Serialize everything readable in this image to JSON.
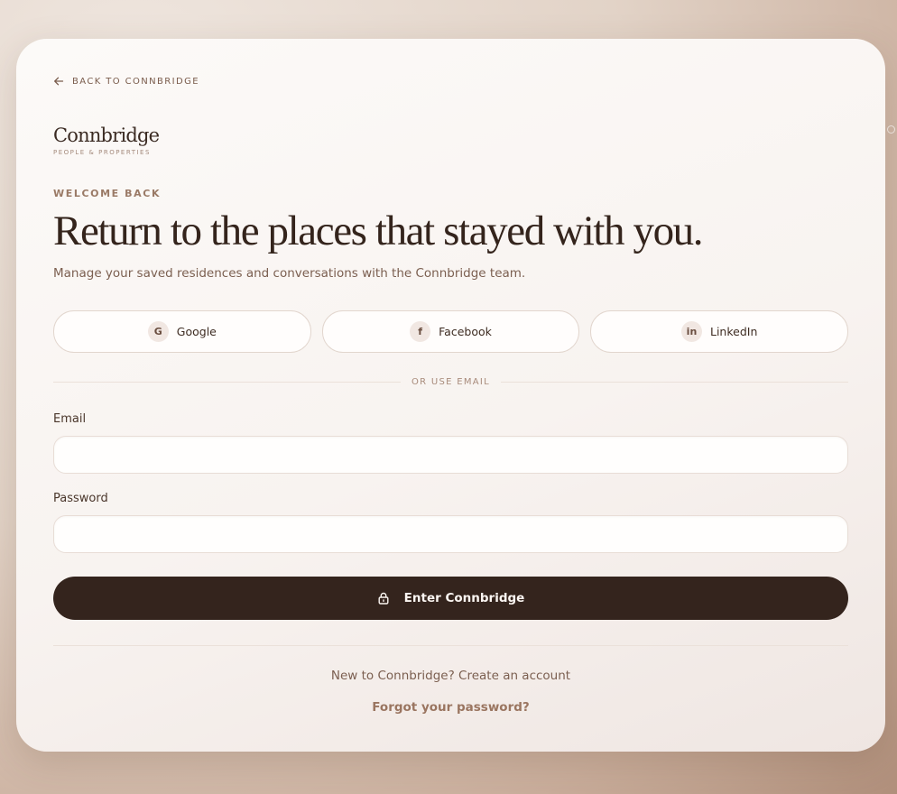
{
  "back_link": {
    "label": "BACK TO CONNBRIDGE",
    "icon": "arrow-left-icon"
  },
  "brand": {
    "name": "Connbridge",
    "tagline": "PEOPLE & PROPERTIES"
  },
  "hero": {
    "eyebrow": "WELCOME BACK",
    "title": "Return to the places that stayed with you.",
    "subtitle": "Manage your saved residences and conversations with the Connbridge team."
  },
  "social": [
    {
      "badge": "G",
      "label": "Google",
      "icon": "google-icon"
    },
    {
      "badge": "f",
      "label": "Facebook",
      "icon": "facebook-icon"
    },
    {
      "badge": "in",
      "label": "LinkedIn",
      "icon": "linkedin-icon"
    }
  ],
  "divider_text": "OR USE EMAIL",
  "form": {
    "email_label": "Email",
    "email_value": "",
    "password_label": "Password",
    "password_value": "",
    "submit_label": "Enter Connbridge",
    "submit_icon": "lock-icon"
  },
  "footer": {
    "signup_text": "New to Connbridge? Create an account",
    "forgot_text": "Forgot your password?"
  },
  "colors": {
    "primary": "#34241d",
    "accent": "#9a7560",
    "text": "#3a2a22",
    "muted": "#7b5f50"
  }
}
